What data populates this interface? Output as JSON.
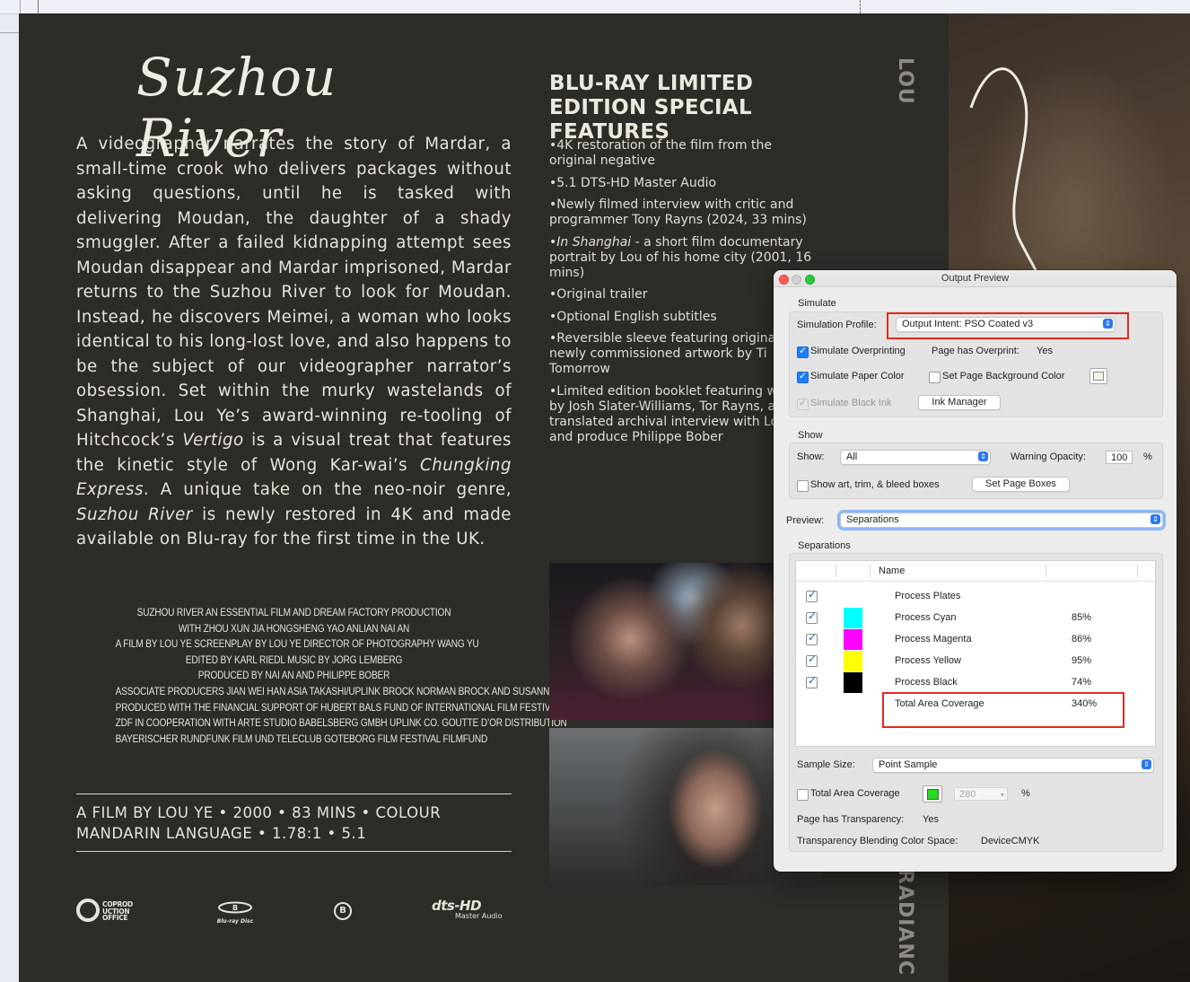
{
  "cover": {
    "title_script": "Suzhou River",
    "synopsis_parts": [
      "A videographer narrates the story of Mardar, a small-time crook who delivers packages without asking questions, until he is tasked with delivering Moudan, the daughter of a shady smuggler. After a failed kidnapping attempt sees Moudan disappear and Mardar imprisoned, Mardar returns to the Suzhou River to look for Moudan. Instead, he discovers Meimei, a woman who looks identical to his long-lost love, and also happens to be the subject of our videographer narrator’s obsession. Set within the murky wastelands of Shanghai, Lou Ye’s award-winning re-tooling of Hitchcock’s ",
      "Vertigo",
      " is a visual treat that features the kinetic style of Wong Kar-wai’s ",
      "Chungking Express",
      ". A unique take on the neo-noir genre, ",
      "Suzhou River",
      " is newly restored in 4K and made available on Blu-ray for the first time in the UK."
    ],
    "credits": [
      "SUZHOU RIVER AN ESSENTIAL FILM AND DREAM FACTORY PRODUCTION",
      "WITH ZHOU XUN  JIA HONGSHENG  YAO ANLIAN  NAI AN",
      "A FILM BY LOU YE SCREENPLAY BY LOU YE DIRECTOR OF PHOTOGRAPHY WANG YU",
      "EDITED BY KARL RIEDL MUSIC BY JORG LEMBERG",
      "PRODUCED BY NAI AN AND PHILIPPE BOBER",
      "ASSOCIATE PRODUCERS JIAN WEI HAN ASIA TAKASHI/UPLINK BROCK NORMAN BROCK AND SUSANNE MARIAN",
      "PRODUCED WITH THE FINANCIAL SUPPORT OF HUBERT BALS FUND OF INTERNATIONAL FILM FESTIVAL ROTTERDAM",
      "ZDF IN COOPERATION WITH ARTE STUDIO BABELSBERG GMBH UPLINK CO. GOUTTE D’OR DISTRIBUTION",
      "BAYERISCHER RUNDFUNK FILM UND TELECLUB GOTEBORG FILM FESTIVAL FILMFUND"
    ],
    "film_info_line1": "A FILM BY LOU YE • 2000 • 83 MINS • COLOUR",
    "film_info_line2": "MANDARIN LANGUAGE • 1.78:1 • 5.1",
    "logos": {
      "coproduction": "COPROD UCTION OFFICE",
      "bluray": "Blu-ray Disc",
      "rating": "B",
      "dts": "dts-HD",
      "dts_sub": "Master Audio"
    },
    "features_title": "BLU-RAY LIMITED EDITION SPECIAL FEATURES",
    "features": [
      {
        "italic": "",
        "text": "4K restoration of the film from the original negative"
      },
      {
        "italic": "",
        "text": "5.1 DTS-HD Master Audio"
      },
      {
        "italic": "",
        "text": "Newly filmed interview with critic and programmer Tony Rayns (2024, 33 mins)"
      },
      {
        "italic": "In Shanghai",
        "text": " - a short film documentary portrait by Lou of his home city (2001, 16 mins)"
      },
      {
        "italic": "",
        "text": "Original trailer"
      },
      {
        "italic": "",
        "text": "Optional English subtitles"
      },
      {
        "italic": "",
        "text": "Reversible sleeve featuring original and newly commissioned artwork by Ti Tomorrow"
      },
      {
        "italic": "",
        "text": "Limited edition booklet featuring writing by Josh Slater-Williams, Tor Rayns, a newly translated archival interview with Lou Ye and produce Philippe Bober"
      }
    ],
    "spine_top": "LOU",
    "spine_bottom": "RADIANC"
  },
  "dialog": {
    "title": "Output Preview",
    "simulate": {
      "group_label": "Simulate",
      "profile_label": "Simulation Profile:",
      "profile_value": "Output Intent: PSO Coated v3",
      "overprinting_label": "Simulate Overprinting",
      "overprinting_checked": true,
      "page_overprint_label": "Page has Overprint:",
      "page_overprint_value": "Yes",
      "paper_color_label": "Simulate Paper Color",
      "paper_color_checked": true,
      "page_bg_label": "Set Page Background Color",
      "page_bg_checked": false,
      "black_ink_label": "Simulate Black Ink",
      "ink_manager_label": "Ink Manager"
    },
    "show": {
      "group_label": "Show",
      "show_label": "Show:",
      "show_value": "All",
      "warning_opacity_label": "Warning Opacity:",
      "warning_opacity_value": "100",
      "percent": "%",
      "boxes_label": "Show art, trim, & bleed boxes",
      "set_page_boxes_label": "Set Page Boxes"
    },
    "preview_label": "Preview:",
    "preview_value": "Separations",
    "separations": {
      "group_label": "Separations",
      "name_header": "Name",
      "rows": [
        {
          "name": "Process Plates",
          "pct": "",
          "color": ""
        },
        {
          "name": "Process Cyan",
          "pct": "85%",
          "color": "#00ffff"
        },
        {
          "name": "Process Magenta",
          "pct": "86%",
          "color": "#ff00ff"
        },
        {
          "name": "Process Yellow",
          "pct": "95%",
          "color": "#ffff00"
        },
        {
          "name": "Process Black",
          "pct": "74%",
          "color": "#000000"
        }
      ],
      "total_name": "Total Area Coverage",
      "total_pct": "340%"
    },
    "sample_size_label": "Sample Size:",
    "sample_size_value": "Point Sample",
    "tac_label": "Total Area Coverage",
    "tac_value": "280",
    "tac_percent": "%",
    "tac_color": "#22dd22",
    "transparency_label": "Page has Transparency:",
    "transparency_value": "Yes",
    "blend_label": "Transparency Blending Color Space:",
    "blend_value": "DeviceCMYK"
  },
  "annotation_color": "#e02b20"
}
